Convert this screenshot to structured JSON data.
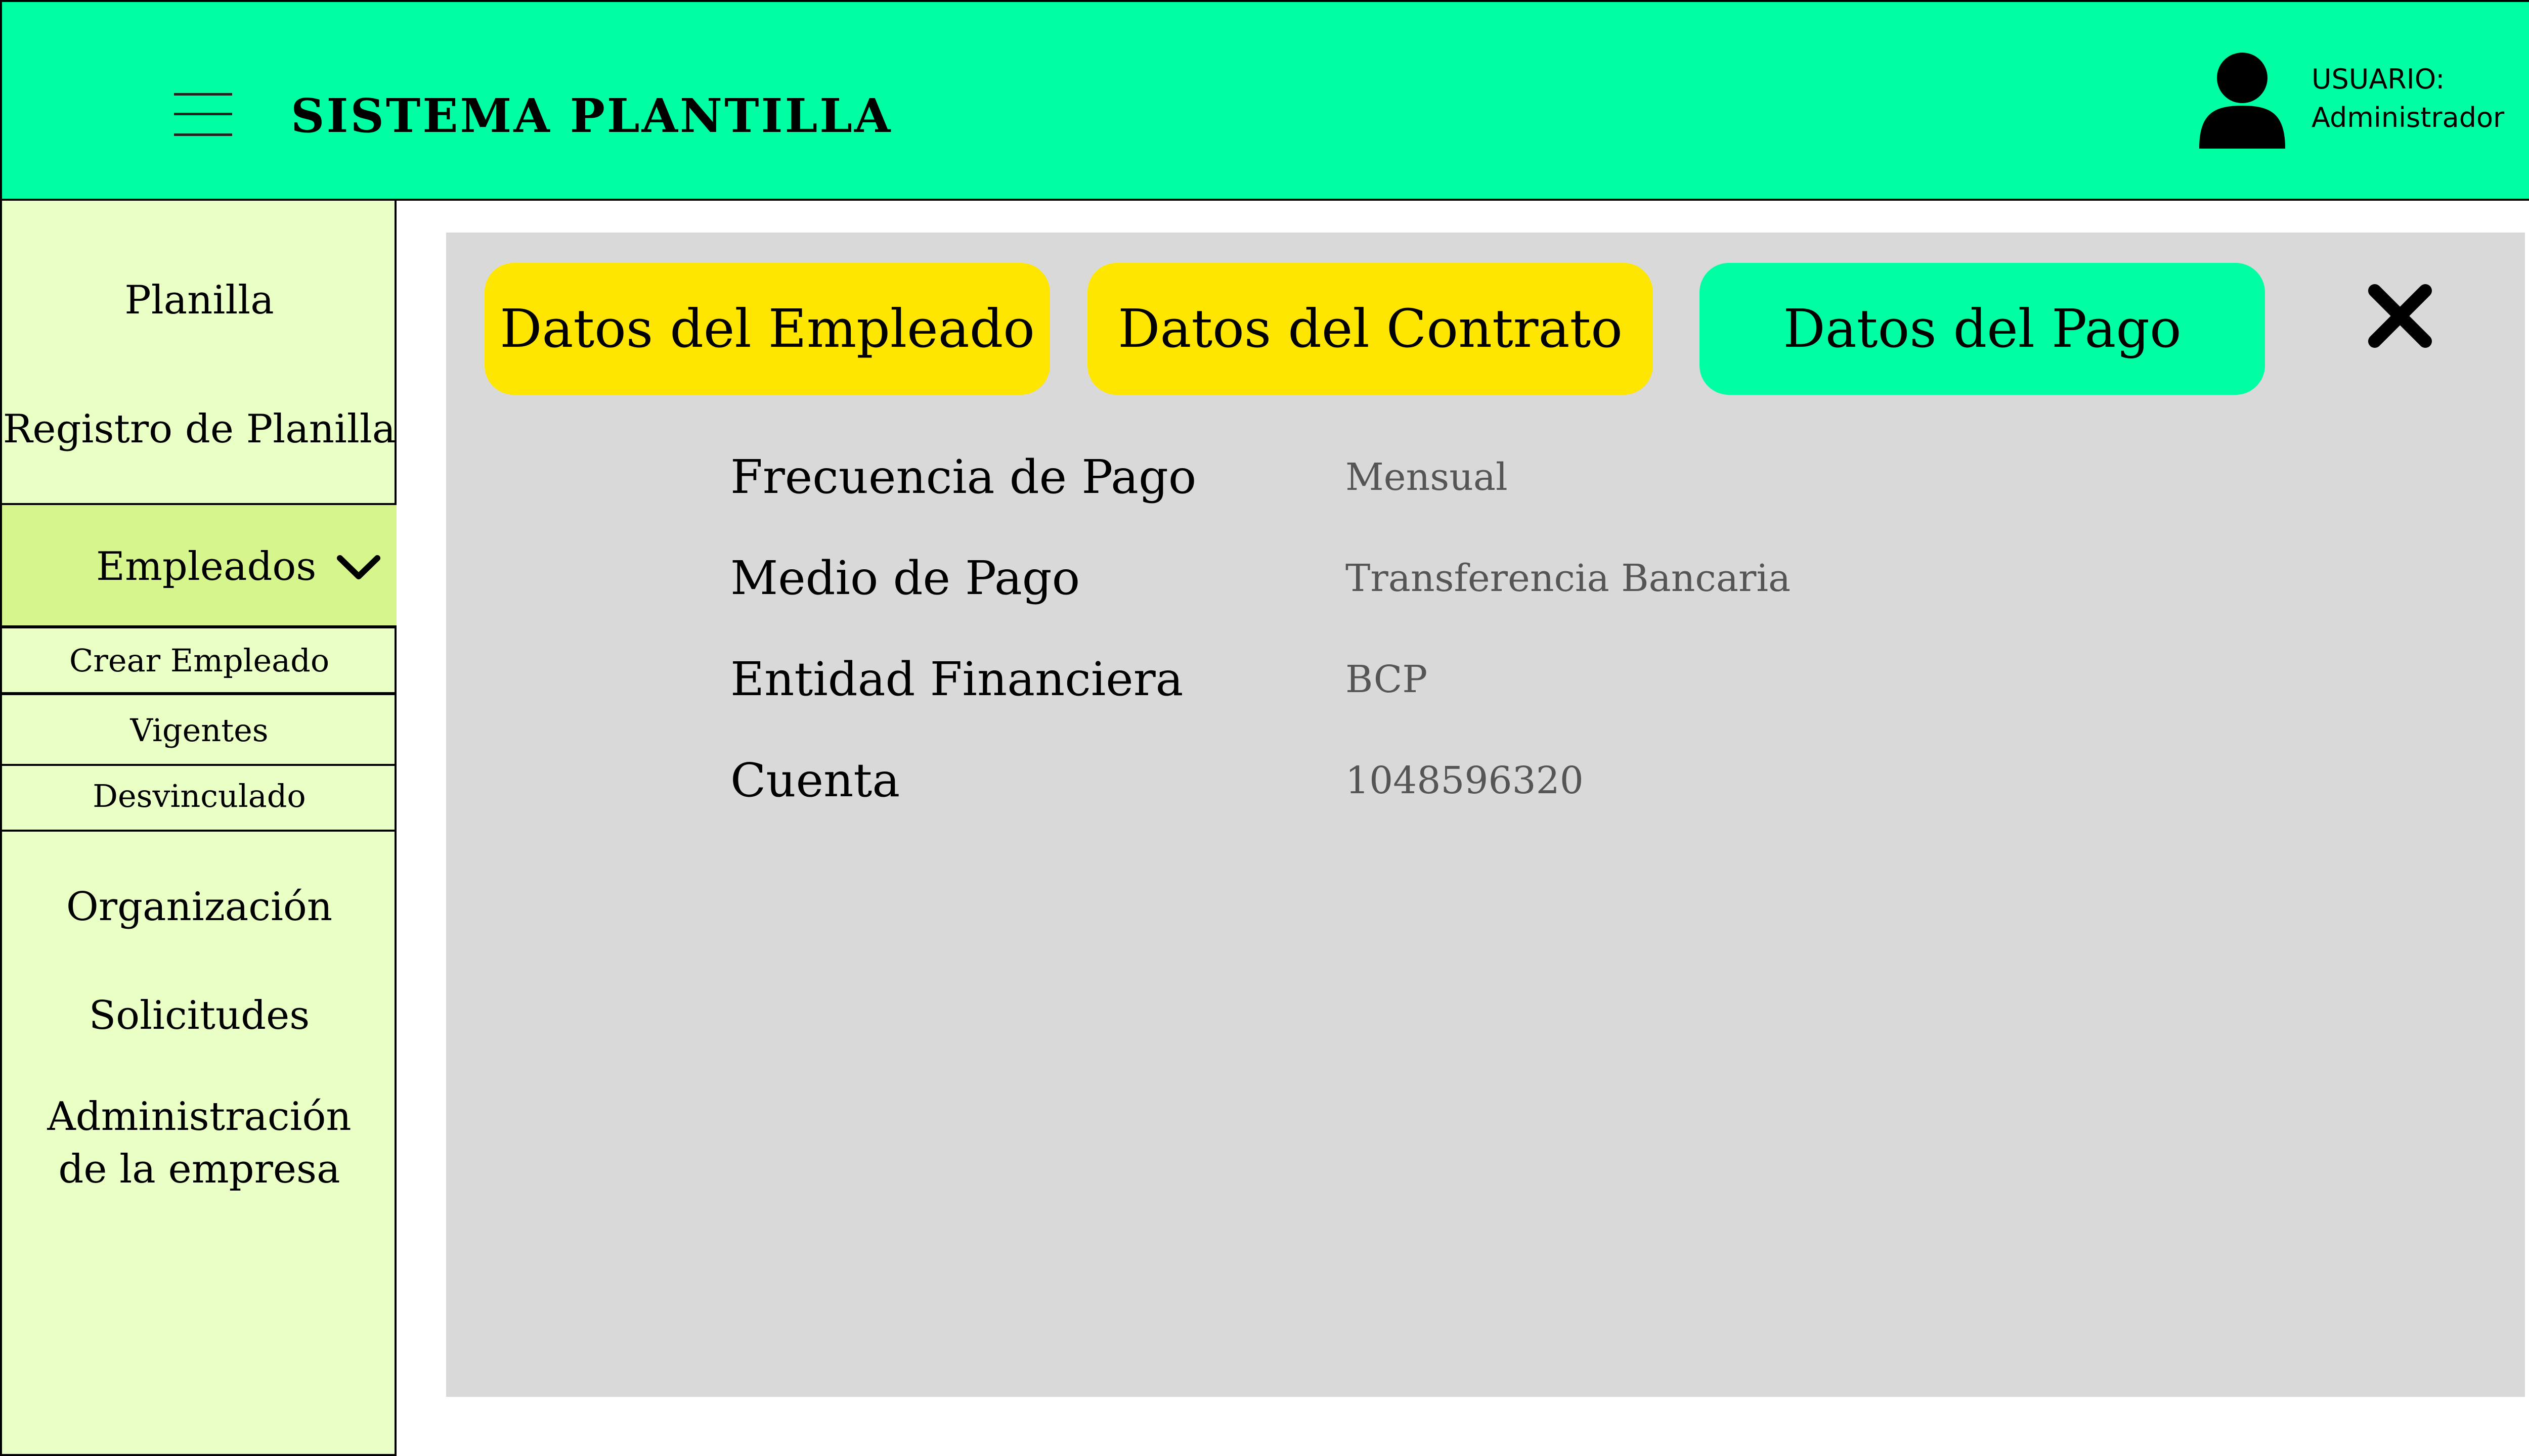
{
  "header": {
    "title": "SISTEMA PLANTILLA",
    "user_label": "USUARIO:",
    "user_name": "Administrador",
    "menu_icon": "hamburger-menu-icon",
    "user_icon": "user-avatar-icon",
    "bg_color": "#00ffa3"
  },
  "sidebar": {
    "bg_color": "#e9ffc6",
    "active_bg_color": "#d6f58c",
    "items": [
      {
        "label": "Planilla"
      },
      {
        "label": "Registro de Planilla"
      },
      {
        "label": "Empleados",
        "expanded": true
      },
      {
        "label": "Organización"
      },
      {
        "label": "Solicitudes"
      },
      {
        "label_line1": "Administración",
        "label_line2": "de la empresa"
      }
    ],
    "empleados_submenu": [
      {
        "label": "Crear Empleado"
      },
      {
        "label": "Vigentes"
      },
      {
        "label": "Desvinculado"
      }
    ]
  },
  "panel": {
    "bg_color": "#d9d9d9",
    "tabs": [
      {
        "label": "Datos del Empleado",
        "color": "#ffe600",
        "active": false
      },
      {
        "label": "Datos del Contrato",
        "color": "#ffe600",
        "active": false
      },
      {
        "label": "Datos del Pago",
        "color": "#00ffa3",
        "active": true
      }
    ],
    "close_icon": "close-x-icon",
    "fields": [
      {
        "label": "Frecuencia de Pago",
        "value": "Mensual"
      },
      {
        "label": "Medio de Pago",
        "value": "Transferencia Bancaria"
      },
      {
        "label": "Entidad Financiera",
        "value": "BCP"
      },
      {
        "label": "Cuenta",
        "value": "1048596320"
      }
    ]
  }
}
